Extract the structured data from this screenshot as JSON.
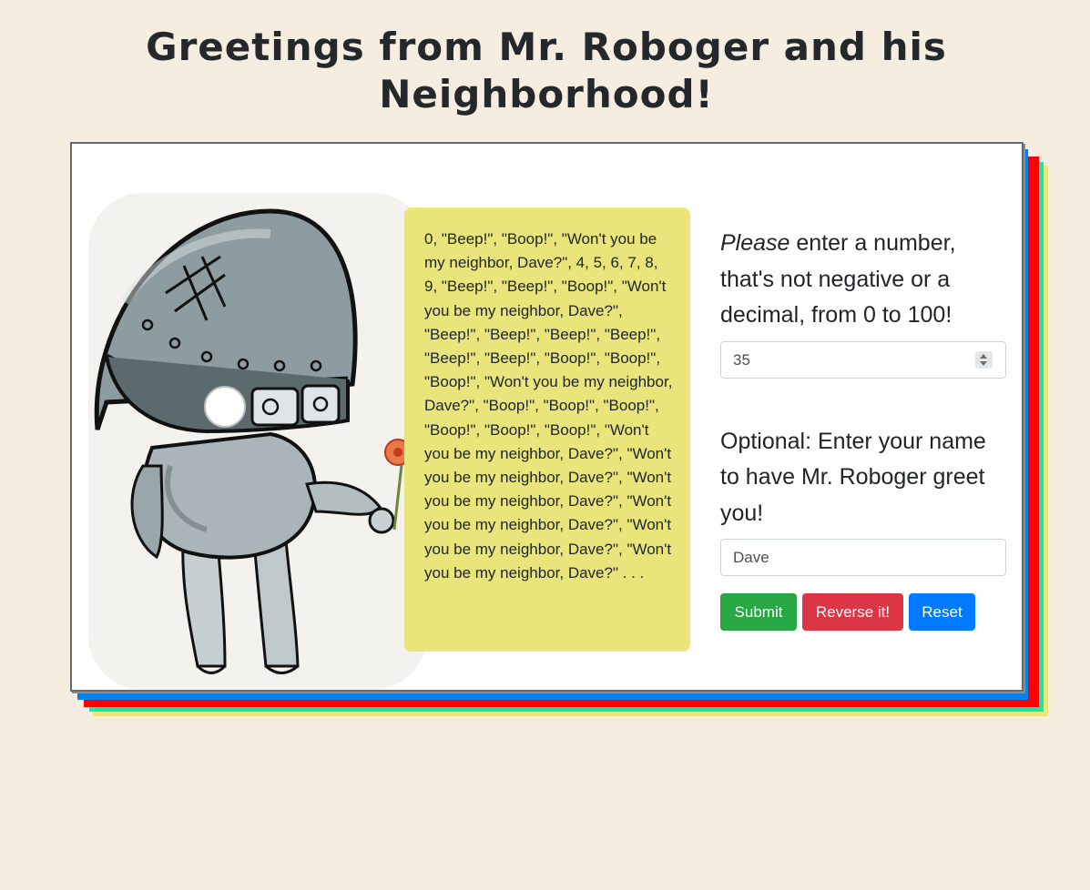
{
  "page": {
    "title": "Greetings from Mr. Roboger and his Neighborhood!"
  },
  "output": {
    "text": "0, \"Beep!\", \"Boop!\", \"Won't you be my neighbor, Dave?\", 4, 5, 6, 7, 8, 9, \"Beep!\", \"Beep!\", \"Boop!\", \"Won't you be my neighbor, Dave?\", \"Beep!\", \"Beep!\", \"Beep!\", \"Beep!\", \"Beep!\", \"Beep!\", \"Boop!\", \"Boop!\", \"Boop!\", \"Won't you be my neighbor, Dave?\", \"Boop!\", \"Boop!\", \"Boop!\", \"Boop!\", \"Boop!\", \"Boop!\", \"Won't you be my neighbor, Dave?\", \"Won't you be my neighbor, Dave?\", \"Won't you be my neighbor, Dave?\", \"Won't you be my neighbor, Dave?\", \"Won't you be my neighbor, Dave?\", \"Won't you be my neighbor, Dave?\" . . ."
  },
  "form": {
    "number_prompt_emphasis": "Please",
    "number_prompt_rest": " enter a number, that's not negative or a decimal, from 0 to 100!",
    "number_value": "35",
    "name_prompt": "Optional: Enter your name to have Mr. Roboger greet you!",
    "name_value": "Dave"
  },
  "buttons": {
    "submit": "Submit",
    "reverse": "Reverse it!",
    "reset": "Reset"
  },
  "colors": {
    "background": "#f5eee0",
    "bubble": "#e9e57a",
    "submit": "#28a745",
    "reverse": "#dc3545",
    "reset": "#007bff",
    "frame_blue": "#0d7fe8",
    "frame_red": "#ff0000",
    "frame_green": "#19e6a6",
    "frame_yellow": "#e9e67b"
  },
  "icons": {
    "robot_illustration": "robot-with-flower"
  }
}
